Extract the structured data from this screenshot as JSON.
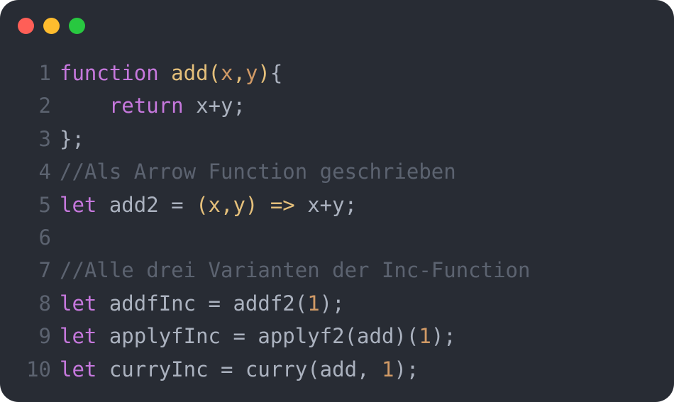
{
  "window": {
    "traffic_lights": [
      {
        "name": "close",
        "color": "#ff5f57"
      },
      {
        "name": "minimize",
        "color": "#febc2e"
      },
      {
        "name": "zoom",
        "color": "#28c840"
      }
    ]
  },
  "theme": {
    "background": "#282c34",
    "default": "#abb2bf",
    "keyword": "#c678dd",
    "function": "#e5c07b",
    "param": "#d19a66",
    "comment": "#5c6370",
    "number": "#d19a66",
    "gutter": "#5c6370"
  },
  "code": {
    "lines": [
      {
        "num": "1",
        "tokens": [
          {
            "t": "function",
            "c": "keyword"
          },
          {
            "t": " ",
            "c": "default"
          },
          {
            "t": "add",
            "c": "function"
          },
          {
            "t": "(",
            "c": "function"
          },
          {
            "t": "x",
            "c": "param"
          },
          {
            "t": ",",
            "c": "function"
          },
          {
            "t": "y",
            "c": "param"
          },
          {
            "t": ")",
            "c": "function"
          },
          {
            "t": "{",
            "c": "default"
          }
        ]
      },
      {
        "num": "2",
        "tokens": [
          {
            "t": "    ",
            "c": "default"
          },
          {
            "t": "return",
            "c": "keyword"
          },
          {
            "t": " x+y;",
            "c": "default"
          }
        ]
      },
      {
        "num": "3",
        "tokens": [
          {
            "t": "};",
            "c": "default"
          }
        ]
      },
      {
        "num": "4",
        "tokens": [
          {
            "t": "//Als Arrow Function geschrieben",
            "c": "comment"
          }
        ]
      },
      {
        "num": "5",
        "tokens": [
          {
            "t": "let",
            "c": "keyword"
          },
          {
            "t": " add2 = ",
            "c": "default"
          },
          {
            "t": "(x,y) =>",
            "c": "function"
          },
          {
            "t": " x+y;",
            "c": "default"
          }
        ]
      },
      {
        "num": "6",
        "tokens": []
      },
      {
        "num": "7",
        "tokens": [
          {
            "t": "//Alle drei Varianten der Inc-Function",
            "c": "comment"
          }
        ]
      },
      {
        "num": "8",
        "tokens": [
          {
            "t": "let",
            "c": "keyword"
          },
          {
            "t": " addfInc = addf2(",
            "c": "default"
          },
          {
            "t": "1",
            "c": "number"
          },
          {
            "t": ");",
            "c": "default"
          }
        ]
      },
      {
        "num": "9",
        "tokens": [
          {
            "t": "let",
            "c": "keyword"
          },
          {
            "t": " applyfInc = applyf2(add)(",
            "c": "default"
          },
          {
            "t": "1",
            "c": "number"
          },
          {
            "t": ");",
            "c": "default"
          }
        ]
      },
      {
        "num": "10",
        "tokens": [
          {
            "t": "let",
            "c": "keyword"
          },
          {
            "t": " curryInc = curry(add, ",
            "c": "default"
          },
          {
            "t": "1",
            "c": "number"
          },
          {
            "t": ");",
            "c": "default"
          }
        ]
      }
    ]
  }
}
